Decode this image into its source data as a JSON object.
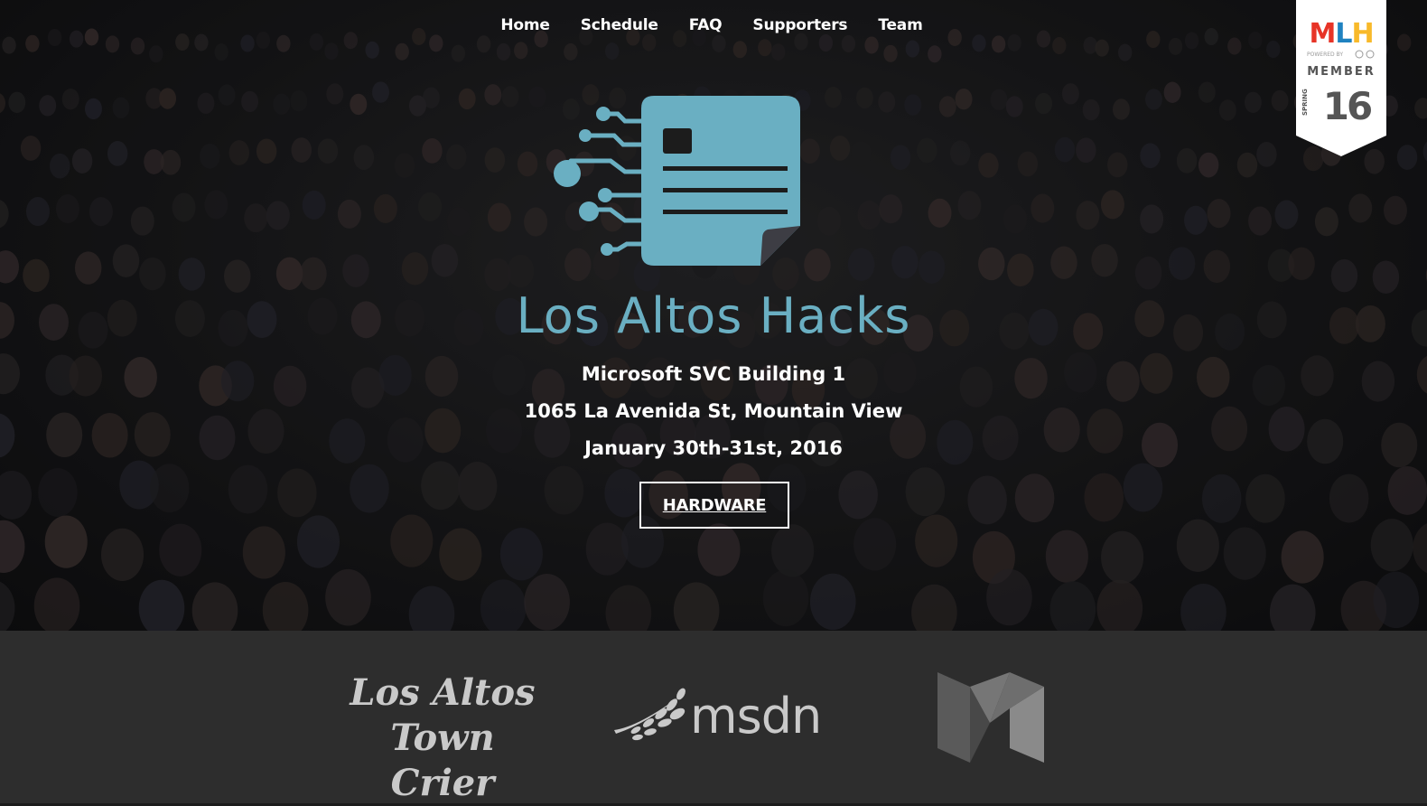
{
  "nav": {
    "items": [
      {
        "label": "Home"
      },
      {
        "label": "Schedule"
      },
      {
        "label": "FAQ"
      },
      {
        "label": "Supporters"
      },
      {
        "label": "Team"
      }
    ]
  },
  "mlh_badge": {
    "brand": "MLH",
    "powered_by": "POWERED BY",
    "member": "MEMBER",
    "season": "SPRING",
    "year": "16"
  },
  "hero": {
    "title": "Los Altos Hacks",
    "venue": "Microsoft SVC Building 1",
    "address": "1065 La Avenida St, Mountain View",
    "date": "January 30th-31st, 2016",
    "cta_label": "HARDWARE"
  },
  "sponsors": {
    "crier_line1": "Los Altos",
    "crier_line2": "Town Crier",
    "msdn": "msdn"
  },
  "colors": {
    "accent": "#6aafc2",
    "sponsor_bar": "#2d2d2d",
    "mlh_red": "#e73427",
    "mlh_blue": "#1f82c0",
    "mlh_yellow": "#f8b92a"
  },
  "icons": {
    "logo": "document-circuit-icon",
    "medium": "medium-logo-icon",
    "msdn": "msdn-branch-icon"
  }
}
